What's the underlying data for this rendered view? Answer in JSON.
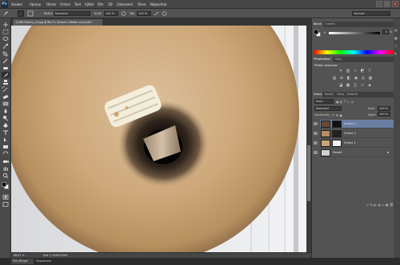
{
  "app": {
    "logo": "Ps"
  },
  "menu": [
    "Soubor",
    "Úpravy",
    "Obraz",
    "Vrstva",
    "Text",
    "Výběr",
    "Filtr",
    "3D",
    "Zobrazení",
    "Okno",
    "Nápověda"
  ],
  "window_controls": {
    "minimize": "–",
    "maximize": "□",
    "close": "×"
  },
  "options": {
    "mode_label": "Režim:",
    "mode_value": "Normální",
    "opacity_label": "Krytí:",
    "opacity_value": "100 %",
    "flow_label": "Tok:",
    "flow_value": "100 %",
    "workspace_value": "Výchozí"
  },
  "document": {
    "tab_title": "1216535shiny_XY.jpg @ 66,7% (Vrstva 1,Maska vrstvy/8) *",
    "close": "×"
  },
  "status": {
    "zoom": "66,67 %",
    "doc_info": "Dok: 1,91M/3,09M"
  },
  "taskbar": {
    "tab1": "Mini Bridge",
    "tab2": "Časová osa"
  },
  "color_panel": {
    "tabs": [
      "Barva",
      "Vzorník"
    ],
    "k_label": "K",
    "k_value": "0",
    "k_unit": "%"
  },
  "adjustments_panel": {
    "tabs": [
      "Přizpůsobení",
      "Styly"
    ],
    "title": "Přidat nastavení",
    "icons": [
      "brightness-icon",
      "levels-icon",
      "curves-icon",
      "exposure-icon",
      "vibrance-icon",
      "hue-icon",
      "balance-icon",
      "bw-icon",
      "photo-filter-icon",
      "channel-mixer-icon",
      "lookup-icon",
      "invert-icon",
      "posterize-icon",
      "threshold-icon",
      "gradient-map-icon",
      "selective-color-icon"
    ]
  },
  "layers_panel": {
    "tabs": [
      "Vrstvy",
      "Kanály",
      "Cesty",
      "Historie"
    ],
    "filter_label": "Druh",
    "blend_value": "Normální",
    "opacity_label": "Krytí:",
    "opacity_value": "100 %",
    "lock_label": "Zamknout:",
    "fill_label": "Výplň:",
    "fill_value": "100 %",
    "layers": [
      {
        "name": "Vrstva 2"
      },
      {
        "name": "Vrstva 3"
      },
      {
        "name": "Vrstva 1"
      },
      {
        "name": "Pozadí"
      }
    ]
  }
}
